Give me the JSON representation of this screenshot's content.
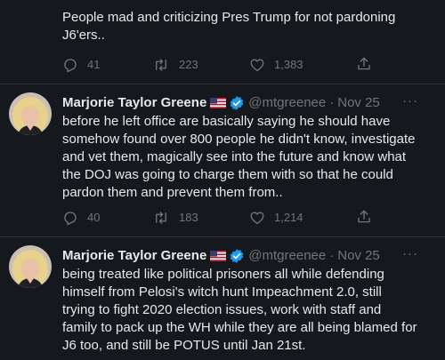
{
  "tweets": [
    {
      "text": "People mad and criticizing Pres Trump for not pardoning\nJ6'ers..",
      "replies": "41",
      "retweets": "223",
      "likes": "1,383"
    },
    {
      "author": "Marjorie Taylor Greene",
      "handle": "@mtgreenee",
      "time": "Nov 25",
      "text": "before he left office are basically saying he should have\nsomehow found over 800 people he didn't know, investigate\nand vet them, magically see into the future and know what\nthe DOJ was going to charge them with so that he could\npardon them and prevent them from..",
      "replies": "40",
      "retweets": "183",
      "likes": "1,214"
    },
    {
      "author": "Marjorie Taylor Greene",
      "handle": "@mtgreenee",
      "time": "Nov 25",
      "text": "being treated like political prisoners all while defending\nhimself from Pelosi's witch hunt Impeachment 2.0, still\ntrying to fight 2020 election issues, work with staff and\nfamily to pack up the WH while they are all being blamed for\nJ6 too, and still be POTUS until Jan 21st."
    }
  ],
  "separator": "·",
  "more_label": "···",
  "icons": {
    "reply": "reply-icon",
    "retweet": "retweet-icon",
    "like": "like-icon",
    "share": "share-icon",
    "flag": "us-flag-icon",
    "verified": "verified-badge-icon",
    "more": "more-options-icon"
  },
  "colors": {
    "background": "#15181c",
    "text": "#e7e9ea",
    "muted": "#71767b",
    "verified": "#1d9bf0",
    "divider": "#2f3336"
  }
}
